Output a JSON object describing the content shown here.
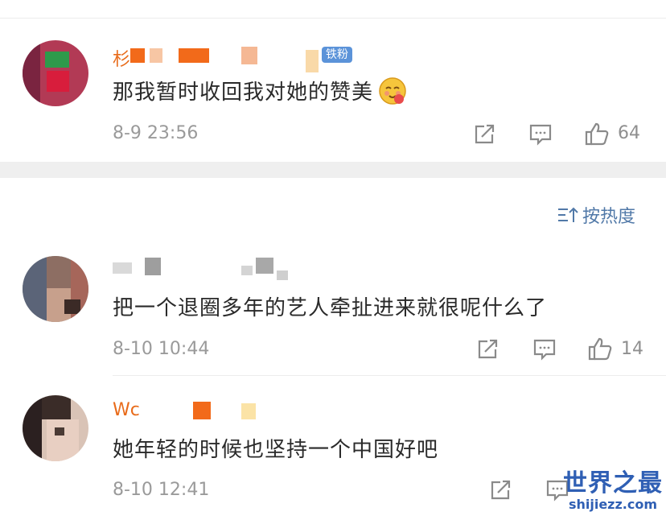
{
  "sort": {
    "label": "按热度"
  },
  "comments": [
    {
      "name_visible": "杉",
      "badge": "铁粉",
      "text": "那我暂时收回我对她的赞美",
      "time": "8-9 23:56",
      "likes": "64"
    },
    {
      "name_visible": "",
      "text": "把一个退圈多年的艺人牵扯进来就很呢什么了",
      "time": "8-10 10:44",
      "likes": "14"
    },
    {
      "name_visible": "Wc",
      "text": "她年轻的时候也坚持一个中国好吧",
      "time": "8-10 12:41",
      "likes": ""
    }
  ],
  "watermark": {
    "title": "世界之最",
    "url": "shijiezz.com"
  },
  "colors": {
    "name": "#e86b1a",
    "badge": "#5b93d9",
    "sort": "#5179a8",
    "watermark": "#2f5fb4"
  },
  "icons": [
    "share-icon",
    "comment-icon",
    "like-icon",
    "sort-icon",
    "emoji-icon"
  ]
}
